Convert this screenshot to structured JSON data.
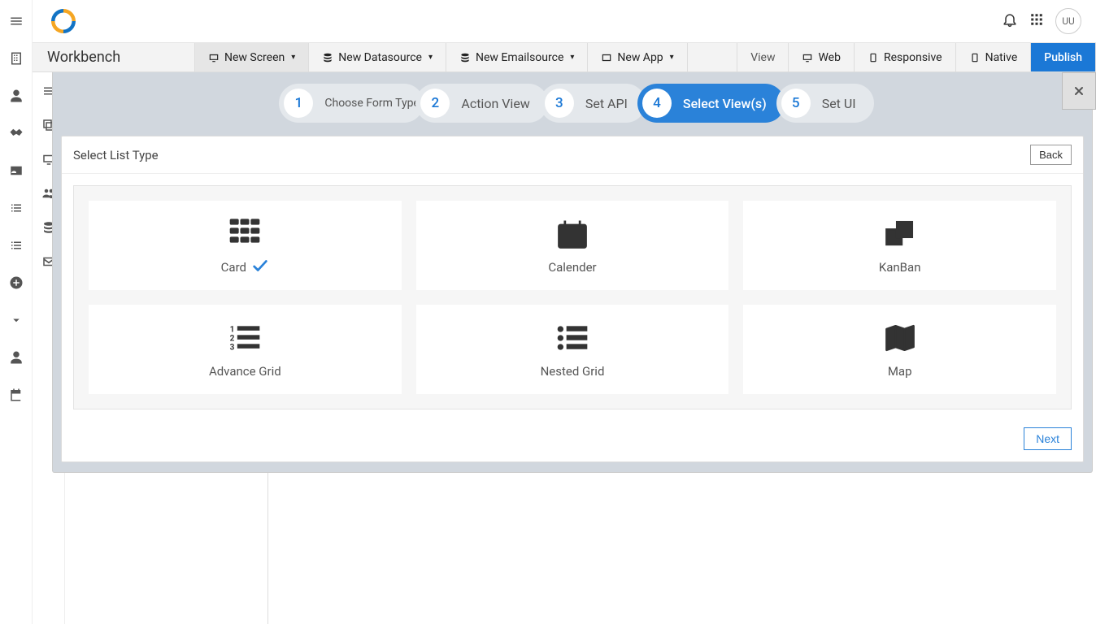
{
  "topbar": {
    "avatar_initials": "UU"
  },
  "ribbon": {
    "title": "Workbench",
    "new_screen": "New Screen",
    "new_datasource": "New Datasource",
    "new_emailsource": "New Emailsource",
    "new_app": "New App",
    "view_label": "View",
    "web": "Web",
    "responsive": "Responsive",
    "native": "Native",
    "publish": "Publish"
  },
  "wizard": {
    "steps": [
      {
        "num": "1",
        "label": "Choose Form Type"
      },
      {
        "num": "2",
        "label": "Action View"
      },
      {
        "num": "3",
        "label": "Set API"
      },
      {
        "num": "4",
        "label": "Select View(s)"
      },
      {
        "num": "5",
        "label": "Set UI"
      }
    ]
  },
  "panel": {
    "heading": "Select List Type",
    "back": "Back",
    "next": "Next"
  },
  "tiles": {
    "card": "Card",
    "calendar": "Calender",
    "kanban": "KanBan",
    "advgrid": "Advance Grid",
    "nested": "Nested Grid",
    "map": "Map"
  }
}
